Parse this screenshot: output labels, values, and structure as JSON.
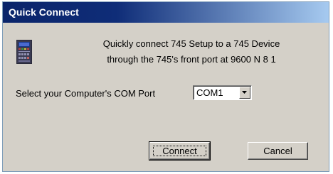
{
  "window": {
    "title": "Quick Connect"
  },
  "message": {
    "line1": "Quickly connect 745 Setup to a 745 Device",
    "line2": "through the 745's front port at 9600 N 8 1"
  },
  "com_port": {
    "label": "Select your Computer's COM Port",
    "selected": "COM1"
  },
  "buttons": {
    "connect": "Connect",
    "cancel": "Cancel"
  },
  "colors": {
    "titlebar_start": "#0a246a",
    "titlebar_end": "#a6caf0",
    "dialog_bg": "#d4d0c8"
  },
  "icons": {
    "device": "device-icon",
    "dropdown": "chevron-down-icon"
  }
}
